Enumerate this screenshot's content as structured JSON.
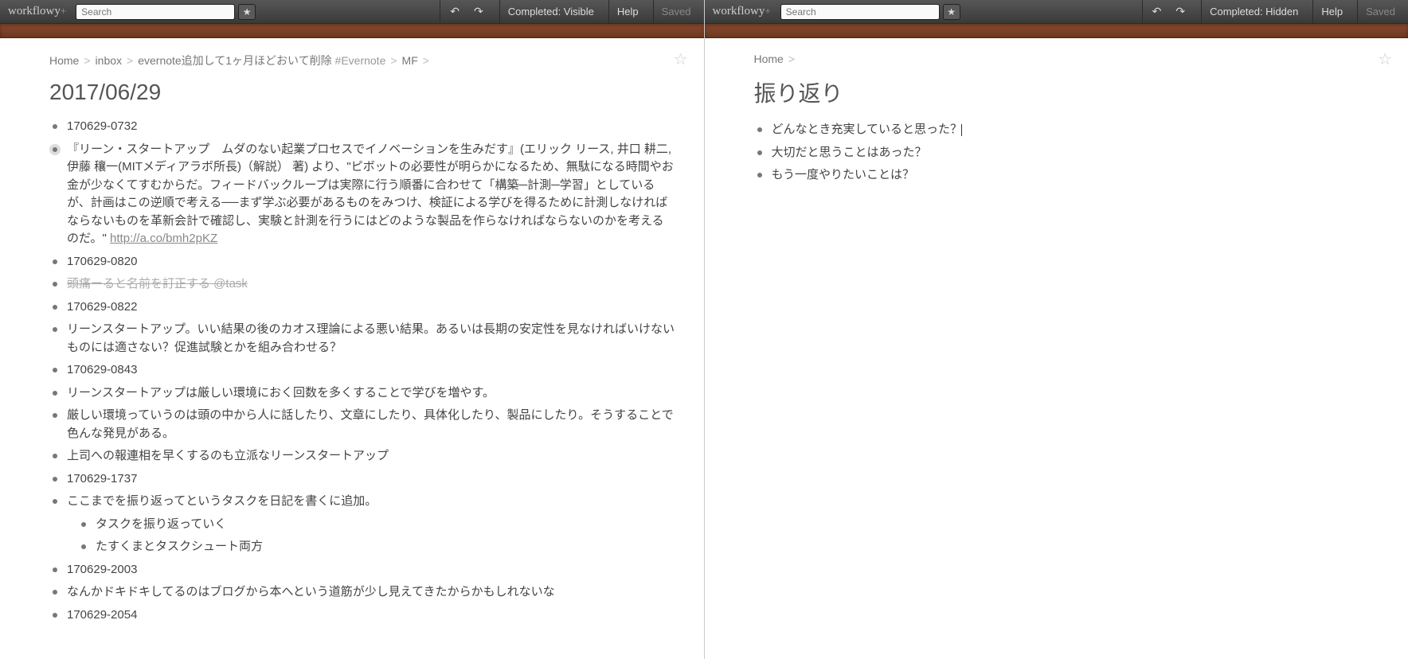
{
  "brand": "workflowy",
  "brand_plus": "+",
  "search_placeholder": "Search",
  "toolbar": {
    "completed_visible": "Completed: Visible",
    "completed_hidden": "Completed: Hidden",
    "help": "Help",
    "saved": "Saved"
  },
  "left": {
    "breadcrumb": [
      {
        "label": "Home",
        "link": true
      },
      {
        "label": "inbox",
        "link": true
      },
      {
        "label": "evernote追加して1ヶ月ほどおいて削除 ",
        "link": true,
        "tag": "#Evernote"
      },
      {
        "label": "MF",
        "link": true
      }
    ],
    "title": "2017/06/29",
    "items": [
      {
        "text": "170629-0732"
      },
      {
        "text": "『リーン・スタートアップ　ムダのない起業プロセスでイノベーションを生みだす』(エリック リース, 井口 耕二, 伊藤 穰一(MITメディアラボ所長)（解説） 著) より、\"ピボットの必要性が明らかになるため、無駄になる時間やお金が少なくてすむからだ。フィードバックループは実際に行う順番に合わせて「構築─計測─学習」としているが、計画はこの逆順で考える──まず学ぶ必要があるものをみつけ、検証による学びを得るために計測しなければならないものを革新会計で確認し、実験と計測を行うにはどのような製品を作らなければならないのかを考えるのだ。\" ",
        "link": "http://a.co/bmh2pKZ",
        "hover": true
      },
      {
        "text": "170629-0820"
      },
      {
        "text": "頭痛ーると名前を訂正する @task",
        "completed": true
      },
      {
        "text": "170629-0822"
      },
      {
        "text": "リーンスタートアップ。いい結果の後のカオス理論による悪い結果。あるいは長期の安定性を見なければいけないものには適さない？促進試験とかを組み合わせる？"
      },
      {
        "text": "170629-0843"
      },
      {
        "text": "リーンスタートアップは厳しい環境におく回数を多くすることで学びを増やす。"
      },
      {
        "text": "厳しい環境っていうのは頭の中から人に話したり、文章にしたり、具体化したり、製品にしたり。そうすることで色んな発見がある。"
      },
      {
        "text": "上司への報連相を早くするのも立派なリーンスタートアップ"
      },
      {
        "text": "170629-1737"
      },
      {
        "text": "ここまでを振り返ってというタスクを日記を書くに追加。",
        "children": [
          {
            "text": "タスクを振り返っていく"
          },
          {
            "text": "たすくまとタスクシュート両方"
          }
        ]
      },
      {
        "text": "170629-2003"
      },
      {
        "text": "なんかドキドキしてるのはブログから本へという道筋が少し見えてきたからかもしれないな"
      },
      {
        "text": "170629-2054"
      }
    ]
  },
  "right": {
    "breadcrumb": [
      {
        "label": "Home",
        "link": true
      }
    ],
    "title": "振り返り",
    "items": [
      {
        "text": "どんなとき充実していると思った？",
        "cursor": true
      },
      {
        "text": "大切だと思うことはあった？"
      },
      {
        "text": "もう一度やりたいことは？"
      }
    ]
  }
}
